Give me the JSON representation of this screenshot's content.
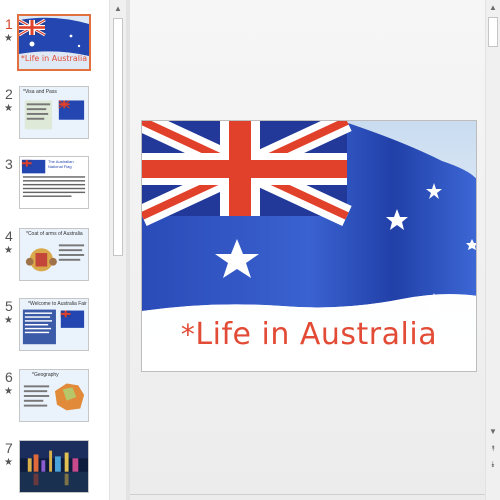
{
  "thumbnails": [
    {
      "number": "1",
      "star": "★",
      "title": "*Life in Australia",
      "selected": true
    },
    {
      "number": "2",
      "star": "★",
      "title": "*Visa and Pass"
    },
    {
      "number": "3",
      "star": "",
      "title": "The Australian National Flag"
    },
    {
      "number": "4",
      "star": "★",
      "title": "*Coat of arms of Australia"
    },
    {
      "number": "5",
      "star": "★",
      "title": "*Welcome to Australia Fair"
    },
    {
      "number": "6",
      "star": "★",
      "title": "*Geography"
    },
    {
      "number": "7",
      "star": "★",
      "title": ""
    }
  ],
  "scroll_arrows": {
    "up": "▲",
    "down": "▼",
    "prev_slide": "⯭",
    "next_slide": "⯯"
  },
  "slide": {
    "title_asterisk": "*",
    "title_text": "Life in Australia"
  },
  "colors": {
    "accent": "#e3703f",
    "flag_blue": "#1f3fa8",
    "flag_red": "#e1402a",
    "title_red": "#e24b35"
  }
}
